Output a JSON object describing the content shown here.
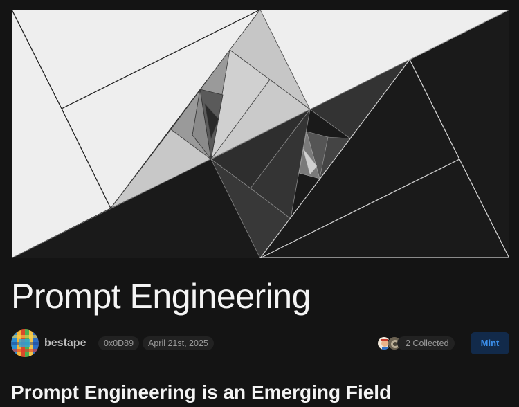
{
  "post": {
    "title": "Prompt Engineering",
    "subheading": "Prompt Engineering is an Emerging Field"
  },
  "author": {
    "name": "bestape",
    "address": "0x0D89",
    "date": "April 21st, 2025"
  },
  "collect": {
    "collected_label": "2 Collected",
    "mint_label": "Mint"
  },
  "colors": {
    "background": "#141414",
    "pill_background": "#222222",
    "mint_background": "#122a4a",
    "mint_text": "#3b8eea",
    "hero_light": "#eeeeee",
    "hero_dark": "#1a1a1a"
  }
}
